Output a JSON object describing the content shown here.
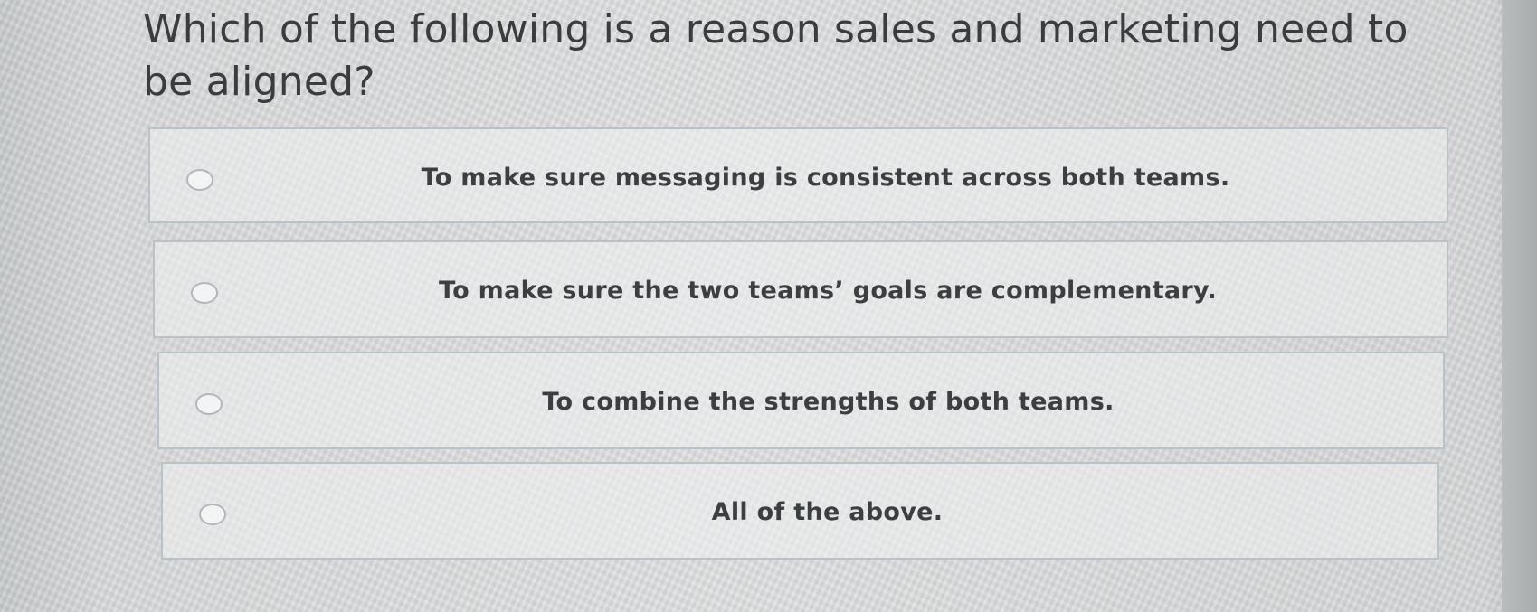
{
  "question": {
    "text": "Which of the following is a reason sales and marketing need to be aligned?"
  },
  "options": [
    {
      "label": "To make sure messaging is consistent across both teams."
    },
    {
      "label": "To make sure the two teams’ goals are complementary."
    },
    {
      "label": "To combine the strengths of both teams."
    },
    {
      "label": "All of the above."
    }
  ]
}
